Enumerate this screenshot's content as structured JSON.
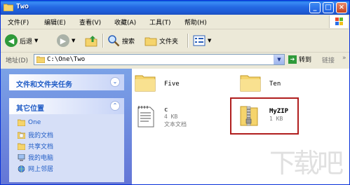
{
  "window": {
    "title": "Two"
  },
  "menu": [
    "文件(F)",
    "编辑(E)",
    "查看(V)",
    "收藏(A)",
    "工具(T)",
    "帮助(H)"
  ],
  "toolbar": {
    "back": "后退",
    "search": "搜索",
    "folders": "文件夹"
  },
  "address": {
    "label": "地址(D)",
    "path": "C:\\One\\Two",
    "go": "转到",
    "links": "链接"
  },
  "sidebar": {
    "tasks_title": "文件和文件夹任务",
    "places_title": "其它位置",
    "places": [
      "One",
      "我的文档",
      "共享文档",
      "我的电脑",
      "网上邻居"
    ]
  },
  "files": [
    {
      "name": "Five",
      "type": "folder"
    },
    {
      "name": "Ten",
      "type": "folder"
    },
    {
      "name": "c",
      "size": "4 KB",
      "kind": "文本文档",
      "type": "text"
    },
    {
      "name": "MyZIP",
      "size": "1 KB",
      "type": "zip"
    }
  ],
  "colors": {
    "title_bar": "#2469e3",
    "sidebar": "#6f8fe0",
    "highlight": "#b01e1e"
  }
}
